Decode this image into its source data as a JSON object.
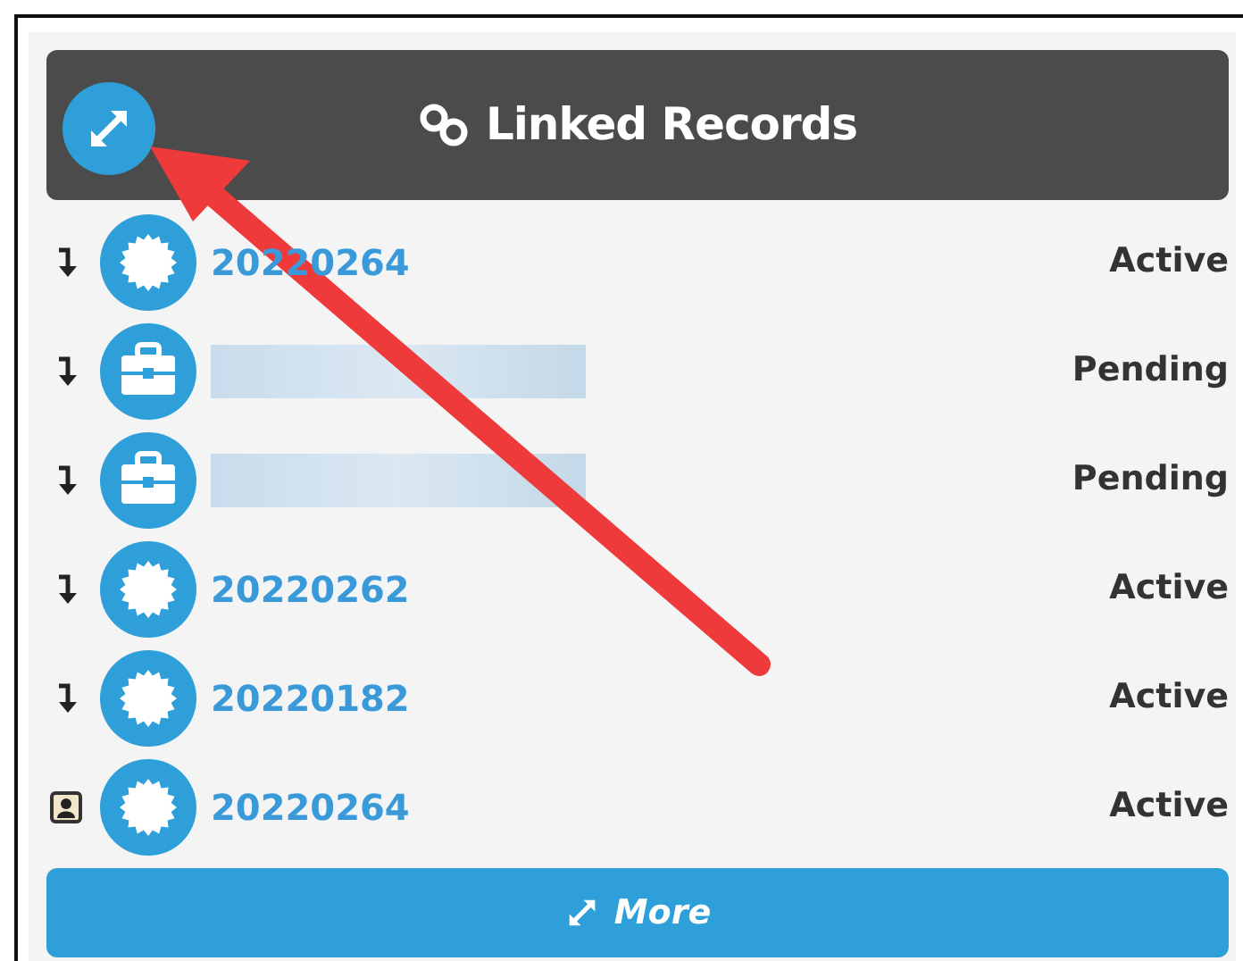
{
  "panel": {
    "title": "Linked Records",
    "expand_button": true
  },
  "records": [
    {
      "contact": false,
      "kind": "seal",
      "redacted": false,
      "name": "20220264",
      "status": "Active"
    },
    {
      "contact": false,
      "kind": "briefcase",
      "redacted": true,
      "status": "Pending"
    },
    {
      "contact": false,
      "kind": "briefcase",
      "redacted": true,
      "status": "Pending"
    },
    {
      "contact": false,
      "kind": "seal",
      "redacted": false,
      "name": "20220262",
      "status": "Active"
    },
    {
      "contact": false,
      "kind": "seal",
      "redacted": false,
      "name": "20220182",
      "status": "Active"
    },
    {
      "contact": true,
      "kind": "seal",
      "redacted": false,
      "name": "20220264",
      "status": "Active"
    }
  ],
  "more_button": {
    "label": "More"
  },
  "annotation": {
    "kind": "arrow"
  }
}
